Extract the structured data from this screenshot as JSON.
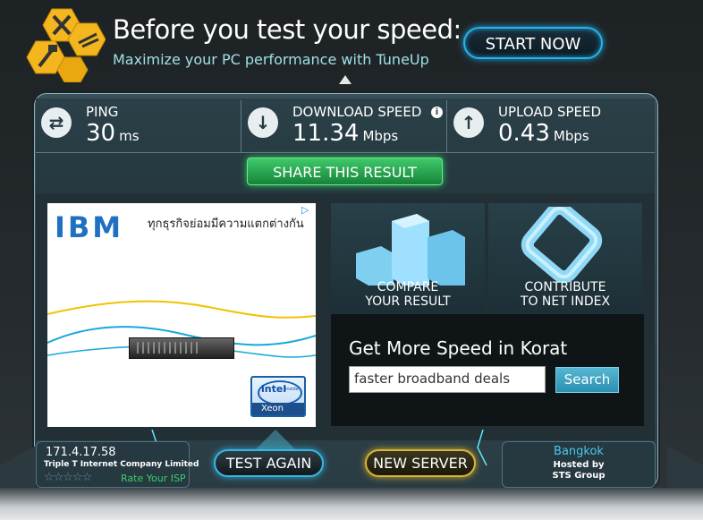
{
  "banner": {
    "title": "Before you test your speed:",
    "subtitle": "Maximize your PC performance with TuneUp",
    "start_button": "START NOW"
  },
  "stats": {
    "ping": {
      "label": "PING",
      "value": "30",
      "unit": "ms"
    },
    "download": {
      "label": "DOWNLOAD SPEED",
      "value": "11.34",
      "unit": "Mbps"
    },
    "upload": {
      "label": "UPLOAD SPEED",
      "value": "0.43",
      "unit": "Mbps"
    }
  },
  "share_button": "SHARE THIS RESULT",
  "ad": {
    "brand": "IBM",
    "text": "ทุกธุรกิจย่อมมีความแตกต่างกัน",
    "badge_brand": "intel",
    "badge_inside": "inside",
    "badge_product": "Xeon"
  },
  "tiles": {
    "compare": {
      "line1": "COMPARE",
      "line2": "YOUR RESULT"
    },
    "contribute": {
      "line1": "CONTRIBUTE",
      "line2": "TO NET INDEX"
    }
  },
  "get_more": {
    "title": "Get More Speed in Korat",
    "input_value": "faster broadband deals",
    "search_button": "Search"
  },
  "isp": {
    "ip": "171.4.17.58",
    "name": "Triple T Internet Company Limited",
    "stars": "☆☆☆☆☆",
    "rate_link": "Rate Your ISP"
  },
  "buttons": {
    "test_again": "TEST AGAIN",
    "new_server": "NEW SERVER"
  },
  "server": {
    "city": "Bangkok",
    "hosted_line1": "Hosted by",
    "hosted_line2": "STS Group"
  },
  "colors": {
    "accent": "#2ab2e8",
    "share_green": "#2fd65c",
    "new_server_gold": "#d8b43a",
    "rate_green": "#3bd06a"
  }
}
